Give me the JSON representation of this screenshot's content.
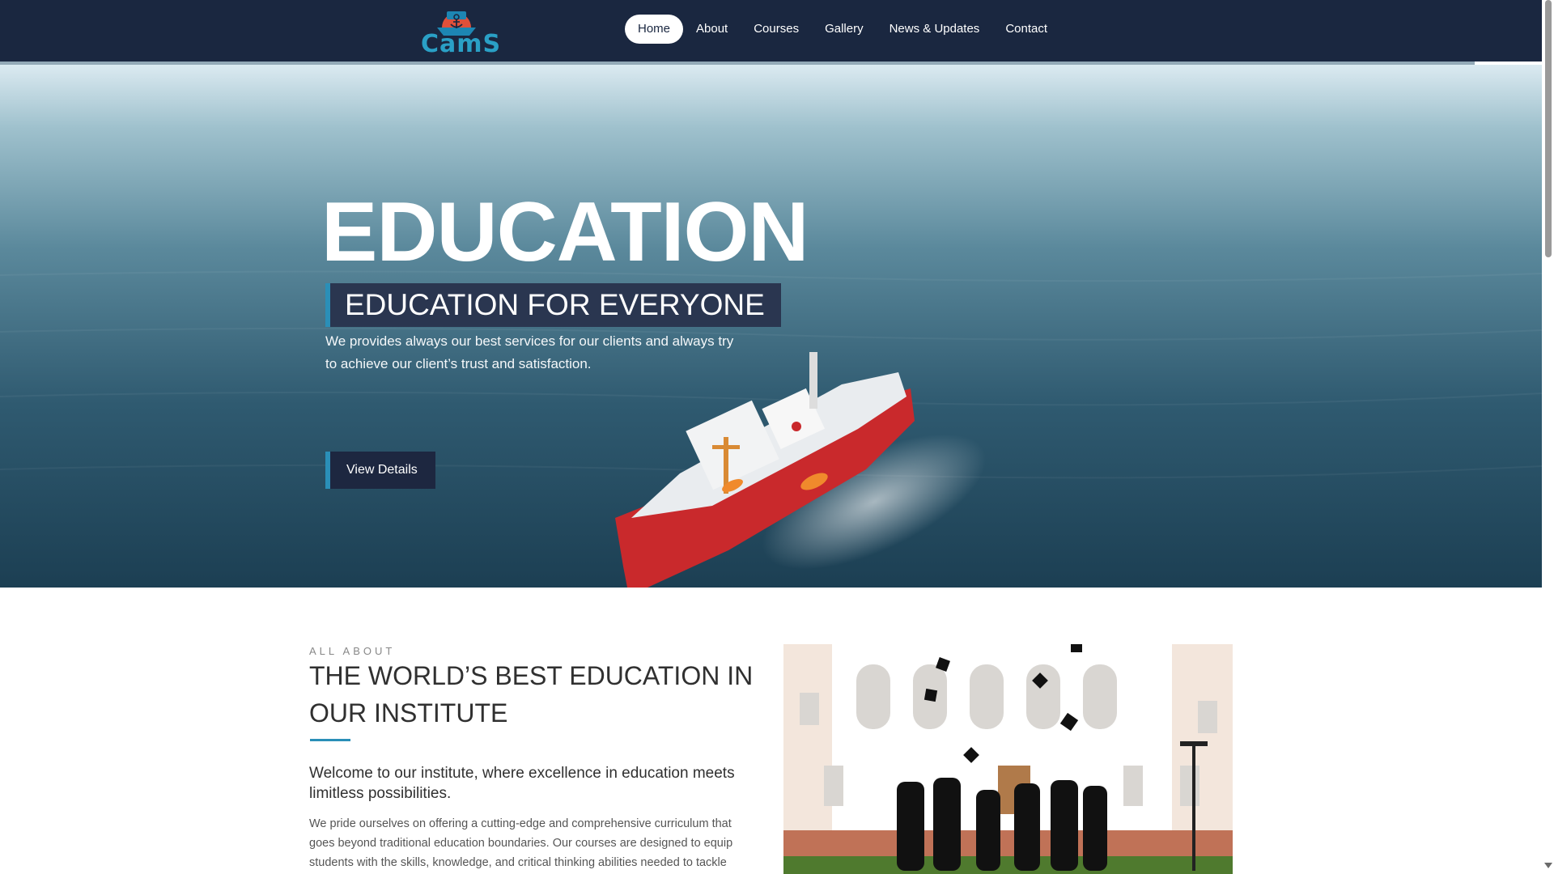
{
  "header": {
    "logo_text": "CamS",
    "nav": [
      {
        "label": "Home",
        "active": true
      },
      {
        "label": "About",
        "active": false
      },
      {
        "label": "Courses",
        "active": false
      },
      {
        "label": "Gallery",
        "active": false
      },
      {
        "label": "News & Updates",
        "active": false
      },
      {
        "label": "Contact",
        "active": false
      }
    ]
  },
  "hero": {
    "title": "EDUCATION",
    "subtitle": "EDUCATION FOR EVERYONE",
    "text": "We provides always our best services for our clients and always try to achieve our client’s trust and satisfaction.",
    "button_label": "View Details"
  },
  "about": {
    "eyebrow": "ALL ABOUT",
    "title": "THE WORLD’S BEST EDUCATION IN OUR INSTITUTE",
    "lead": "Welcome to our institute, where excellence in education meets limitless possibilities.",
    "body": "We pride ourselves on offering a cutting-edge and comprehensive curriculum that goes beyond traditional education boundaries. Our courses are designed to equip students with the skills, knowledge, and critical thinking abilities needed to tackle"
  },
  "colors": {
    "header_bg": "#1a2740",
    "accent": "#2a8fb8",
    "hero_box": "#2a3650",
    "button_bg": "#1d2740"
  },
  "icons": {
    "logo": "anchor-ship-logo"
  }
}
